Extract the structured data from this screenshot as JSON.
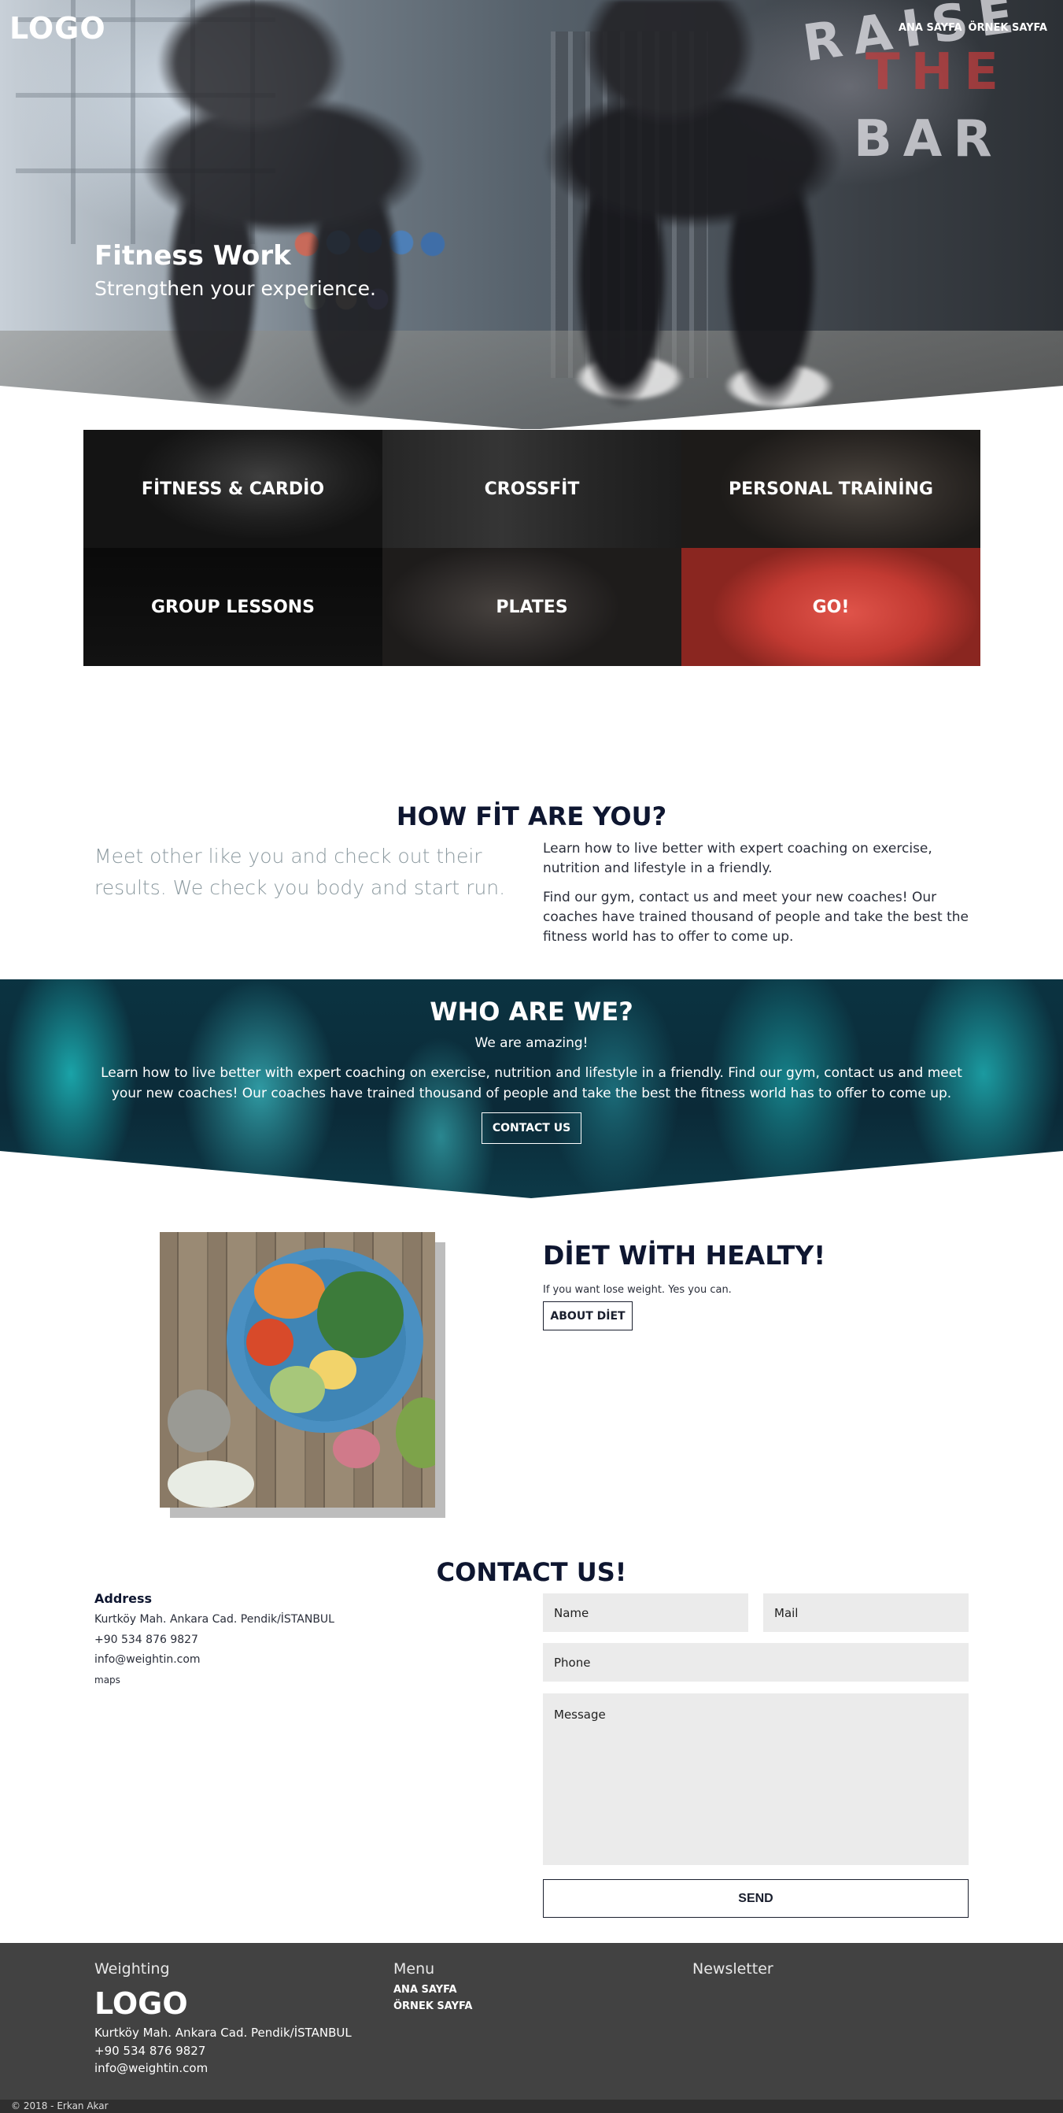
{
  "header": {
    "logo": "LOGO",
    "nav": [
      "ANA SAYFA",
      "ÖRNEK SAYFA"
    ]
  },
  "hero": {
    "title": "Fitness Work",
    "subtitle": "Strengthen your experience.",
    "wall_text": [
      "RAISE",
      "THE",
      "BAR"
    ]
  },
  "services": [
    {
      "label": "FİTNESS & CARDİO"
    },
    {
      "label": "CROSSFİT"
    },
    {
      "label": "PERSONAL TRAİNİNG"
    },
    {
      "label": "GROUP LESSONS"
    },
    {
      "label": "PLATES"
    },
    {
      "label": "GO!"
    }
  ],
  "howfit": {
    "title": "HOW FİT ARE YOU?",
    "lead": "Meet other like you and check out their results. We check you body and start run.",
    "p1": "Learn how to live better with expert coaching on exercise, nutrition and lifestyle in a friendly.",
    "p2": "Find our gym, contact us and meet your new coaches! Our coaches have trained thousand of people and take the best the fitness world has to offer to come up."
  },
  "who": {
    "title": "WHO ARE WE?",
    "tagline": "We are amazing!",
    "text": "Learn how to live better with expert coaching on exercise, nutrition and lifestyle in a friendly. Find our gym, contact us and meet your new coaches! Our coaches have trained thousand of people and take the best the fitness world has to offer to come up.",
    "button": "CONTACT US"
  },
  "diet": {
    "title": "DİET WİTH HEALTY!",
    "subtitle": "If you want lose weight. Yes you can.",
    "button": "ABOUT DİET"
  },
  "contact": {
    "title": "CONTACT US!",
    "address_heading": "Address",
    "address": "Kurtköy Mah. Ankara Cad. Pendik/İSTANBUL",
    "phone": "+90 534 876 9827",
    "email": "info@weightin.com",
    "maps": "maps",
    "form": {
      "name_placeholder": "Name",
      "mail_placeholder": "Mail",
      "phone_placeholder": "Phone",
      "message_placeholder": "Message",
      "send": "SEND"
    }
  },
  "footer": {
    "col1_title": "Weighting",
    "logo": "LOGO",
    "address": "Kurtköy Mah. Ankara Cad. Pendik/İSTANBUL",
    "phone": "+90 534 876 9827",
    "email": "info@weightin.com",
    "col2_title": "Menu",
    "menu": [
      "ANA SAYFA",
      "ÖRNEK SAYFA"
    ],
    "col3_title": "Newsletter",
    "copyright": "© 2018 - Erkan Akar"
  },
  "colors": {
    "navy": "#0e1630",
    "footer_bg": "#424242",
    "go_tile": "#d84a40",
    "field_bg": "#ebebeb"
  }
}
